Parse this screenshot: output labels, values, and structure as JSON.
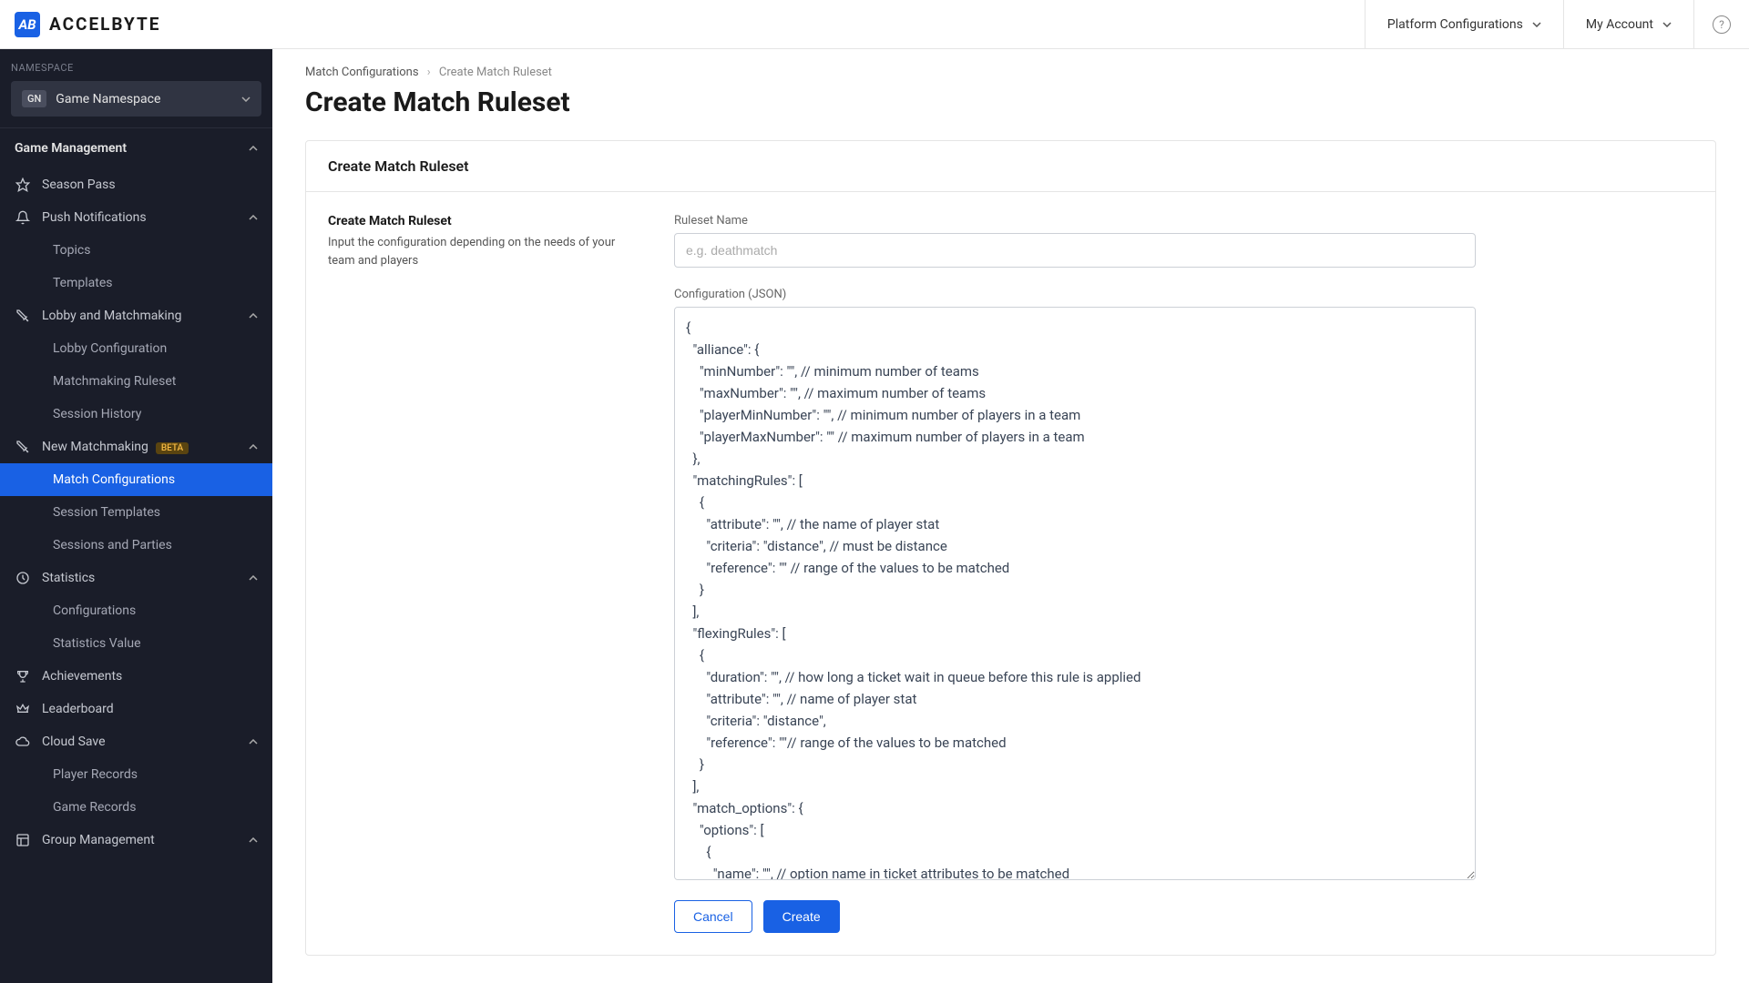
{
  "header": {
    "logo_mark": "AB",
    "logo_text": "ACCELBYTE",
    "platform_config": "Platform Configurations",
    "my_account": "My Account"
  },
  "sidebar": {
    "ns_label": "NAMESPACE",
    "ns_badge": "GN",
    "ns_name": "Game Namespace",
    "section": "Game Management",
    "items": {
      "season_pass": "Season Pass",
      "push_notifications": "Push Notifications",
      "topics": "Topics",
      "templates": "Templates",
      "lobby_mm": "Lobby and Matchmaking",
      "lobby_config": "Lobby Configuration",
      "mm_ruleset": "Matchmaking Ruleset",
      "session_history": "Session History",
      "new_mm": "New Matchmaking",
      "beta": "BETA",
      "match_configs": "Match Configurations",
      "session_templates": "Session Templates",
      "sessions_parties": "Sessions and Parties",
      "statistics": "Statistics",
      "configurations": "Configurations",
      "statistics_value": "Statistics Value",
      "achievements": "Achievements",
      "leaderboard": "Leaderboard",
      "cloud_save": "Cloud Save",
      "player_records": "Player Records",
      "game_records": "Game Records",
      "group_management": "Group Management"
    }
  },
  "breadcrumb": {
    "parent": "Match Configurations",
    "current": "Create Match Ruleset"
  },
  "page": {
    "title": "Create Match Ruleset",
    "card_title": "Create Match Ruleset",
    "left_title": "Create Match Ruleset",
    "left_desc": "Input the configuration depending on the needs of your team and players",
    "ruleset_label": "Ruleset Name",
    "ruleset_ph": "e.g. deathmatch",
    "config_label": "Configuration (JSON)",
    "config_value": "{\n  \"alliance\": {\n    \"minNumber\": \"\", // minimum number of teams\n    \"maxNumber\": \"\", // maximum number of teams\n    \"playerMinNumber\": \"\", // minimum number of players in a team\n    \"playerMaxNumber\": \"\" // maximum number of players in a team\n  },\n  \"matchingRules\": [\n    {\n      \"attribute\": \"\", // the name of player stat\n      \"criteria\": \"distance\", // must be distance\n      \"reference\": \"\" // range of the values to be matched\n    }\n  ],\n  \"flexingRules\": [\n    {\n      \"duration\": \"\", // how long a ticket wait in queue before this rule is applied\n      \"attribute\": \"\", // name of player stat\n      \"criteria\": \"distance\",\n      \"reference\": \"\"// range of the values to be matched\n    }\n  ],\n  \"match_options\": {\n    \"options\": [\n      {\n        \"name\": \"\", // option name in ticket attributes to be matched\n        \"type\": \"\" // \"any\", \"all\", or \"unique\"",
    "cancel": "Cancel",
    "create": "Create"
  }
}
